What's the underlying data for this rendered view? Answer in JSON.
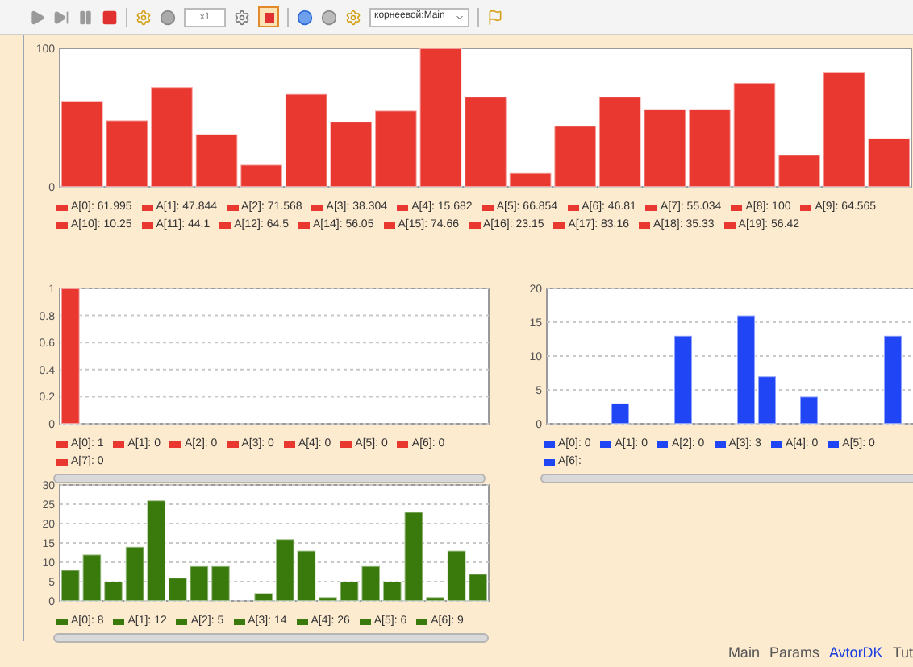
{
  "toolbar": {
    "speed": "x1",
    "experiment": "корнеевой:Main"
  },
  "charts": [
    {
      "scrollbar": false,
      "legend": [
        "A[0]: 61.995",
        "A[1]: 47.844",
        "A[2]: 71.568",
        "A[3]: 38.304",
        "A[4]: 15.682",
        "A[5]: 66.854",
        "A[6]: 46.81",
        "A[7]: 55.034",
        "A[8]: 100",
        "A[9]: 64.565",
        "A[10]: 10.25",
        "A[11]: 44.1",
        "A[12]: 64.5",
        "A[14]: 56.05",
        "A[15]: 74.66",
        "A[16]: 23.15",
        "A[17]: 83.16",
        "A[18]: 35.33",
        "A[19]: 56.42"
      ],
      "chart_data": {
        "type": "bar",
        "grid": false,
        "ylim": [
          0,
          100
        ],
        "yticks": [
          0,
          100
        ],
        "series": [
          {
            "color": "#e8382f",
            "values": [
              62,
              48,
              72,
              38,
              16,
              67,
              47,
              55,
              100,
              65,
              10,
              44,
              65,
              56,
              56,
              75,
              23,
              83,
              35
            ]
          }
        ]
      }
    },
    {
      "scrollbar": true,
      "legend": [
        "A[0]: 1",
        "A[1]: 0",
        "A[2]: 0",
        "A[3]: 0",
        "A[4]: 0",
        "A[5]: 0",
        "A[6]: 0",
        "A[7]: 0"
      ],
      "chart_data": {
        "type": "bar",
        "grid": true,
        "ylim": [
          0,
          1
        ],
        "yticks": [
          0,
          0.2,
          0.4,
          0.6,
          0.8,
          1
        ],
        "series": [
          {
            "color": "#e8382f",
            "values": [
              1,
              0,
              0,
              0,
              0,
              0,
              0,
              0,
              0,
              0,
              0,
              0,
              0,
              0,
              0,
              0,
              0,
              0,
              0,
              0
            ]
          }
        ]
      }
    },
    {
      "scrollbar": true,
      "legend": [
        "A[0]: 0",
        "A[1]: 0",
        "A[2]: 0",
        "A[3]: 3",
        "A[4]: 0",
        "A[5]: 0",
        "A[6]:"
      ],
      "chart_data": {
        "type": "bar",
        "grid": true,
        "ylim": [
          0,
          20
        ],
        "yticks": [
          0,
          5,
          10,
          15,
          20
        ],
        "series": [
          {
            "color": "#1f45f5",
            "values": [
              0,
              0,
              0,
              3,
              0,
              0,
              13,
              0,
              0,
              16,
              7,
              0,
              4,
              0,
              0,
              0,
              13,
              0
            ]
          }
        ]
      }
    },
    {
      "scrollbar": true,
      "legend": [
        "A[0]: 8",
        "A[1]: 12",
        "A[2]: 5",
        "A[3]: 14",
        "A[4]: 26",
        "A[5]: 6",
        "A[6]: 9"
      ],
      "chart_data": {
        "type": "bar",
        "grid": true,
        "ylim": [
          0,
          30
        ],
        "yticks": [
          0,
          5,
          10,
          15,
          20,
          25,
          30
        ],
        "series": [
          {
            "color": "#3a7a0c",
            "values": [
              8,
              12,
              5,
              14,
              26,
              6,
              9,
              9,
              0,
              2,
              16,
              13,
              1,
              5,
              9,
              5,
              23,
              1,
              13,
              7
            ]
          }
        ]
      }
    }
  ],
  "tabs": [
    {
      "label": "Main",
      "selected": false
    },
    {
      "label": "Params",
      "selected": false
    },
    {
      "label": "AvtorDK",
      "selected": true
    },
    {
      "label": "Tut",
      "selected": false
    }
  ]
}
